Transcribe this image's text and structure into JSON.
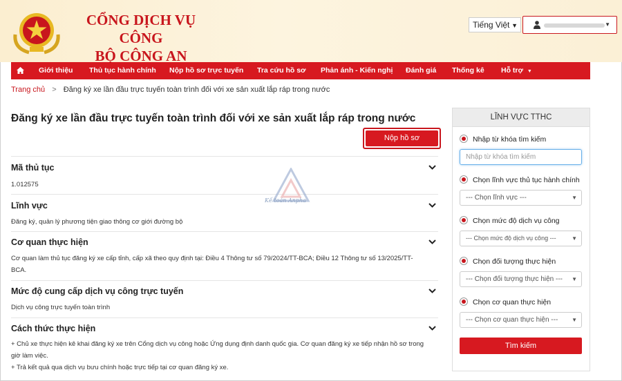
{
  "header": {
    "site_title_line1": "CỔNG DỊCH VỤ CÔNG",
    "site_title_line2": "BỘ CÔNG AN",
    "language": "Tiếng Việt"
  },
  "nav": {
    "items": [
      "Giới thiệu",
      "Thủ tục hành chính",
      "Nộp hồ sơ trực tuyến",
      "Tra cứu hồ sơ",
      "Phản ánh - Kiến nghị",
      "Đánh giá",
      "Thống kê",
      "Hỗ trợ"
    ]
  },
  "breadcrumb": {
    "home": "Trang chủ",
    "separator": ">",
    "current": "Đăng ký xe lần đầu trực tuyến toàn trình đối với xe sản xuất lắp ráp trong nước"
  },
  "procedure": {
    "title": "Đăng ký xe lần đầu trực tuyến toàn trình đối với xe sản xuất lắp ráp trong nước",
    "submit_label": "Nộp hồ sơ",
    "sections": [
      {
        "heading": "Mã thủ tục",
        "body": [
          "1.012575"
        ]
      },
      {
        "heading": "Lĩnh vực",
        "body": [
          "Đăng ký, quản lý phương tiện giao thông cơ giới đường bộ"
        ]
      },
      {
        "heading": "Cơ quan thực hiện",
        "body": [
          "Cơ quan làm thủ tục đăng ký xe cấp tỉnh, cấp xã theo quy định tại: Điều 4 Thông tư số 79/2024/TT-BCA; Điều 12 Thông tư số 13/2025/TT-",
          "BCA."
        ]
      },
      {
        "heading": "Mức độ cung cấp dịch vụ công trực tuyến",
        "body": [
          "Dịch vụ công trực tuyến toàn trình"
        ]
      },
      {
        "heading": "Cách thức thực hiện",
        "body": [
          "+ Chủ xe thực hiện kê khai đăng ký xe trên Cổng dịch vụ công hoặc Ứng dụng định danh quốc gia. Cơ quan đăng ký xe tiếp nhận hồ sơ trong",
          "giờ làm việc.",
          "+ Trả kết quả qua dịch vụ bưu chính hoặc trực tiếp tại cơ quan đăng ký xe."
        ]
      }
    ]
  },
  "sidebar": {
    "heading": "LĨNH VỰC TTHC",
    "keyword_label": "Nhập từ khóa tìm kiếm",
    "keyword_placeholder": "Nhập từ khóa tìm kiếm",
    "field_label": "Chọn lĩnh vực thủ tục hành chính",
    "field_value": "--- Chọn lĩnh vực ---",
    "level_label": "Chọn mức độ dịch vụ công",
    "level_value": "--- Chọn mức độ dịch vụ công ---",
    "subject_label": "Chọn đối tượng thực hiện",
    "subject_value": "--- Chọn đối tượng thực hiện ---",
    "agency_label": "Chọn cơ quan thực hiện",
    "agency_value": "--- Chọn cơ quan thực hiện ---",
    "search_label": "Tìm kiếm"
  },
  "watermark": {
    "text": "Kế toán Anpha"
  },
  "colors": {
    "brand_red": "#d71920",
    "header_bg": "#fbeed0",
    "input_focus": "#66afe9"
  }
}
